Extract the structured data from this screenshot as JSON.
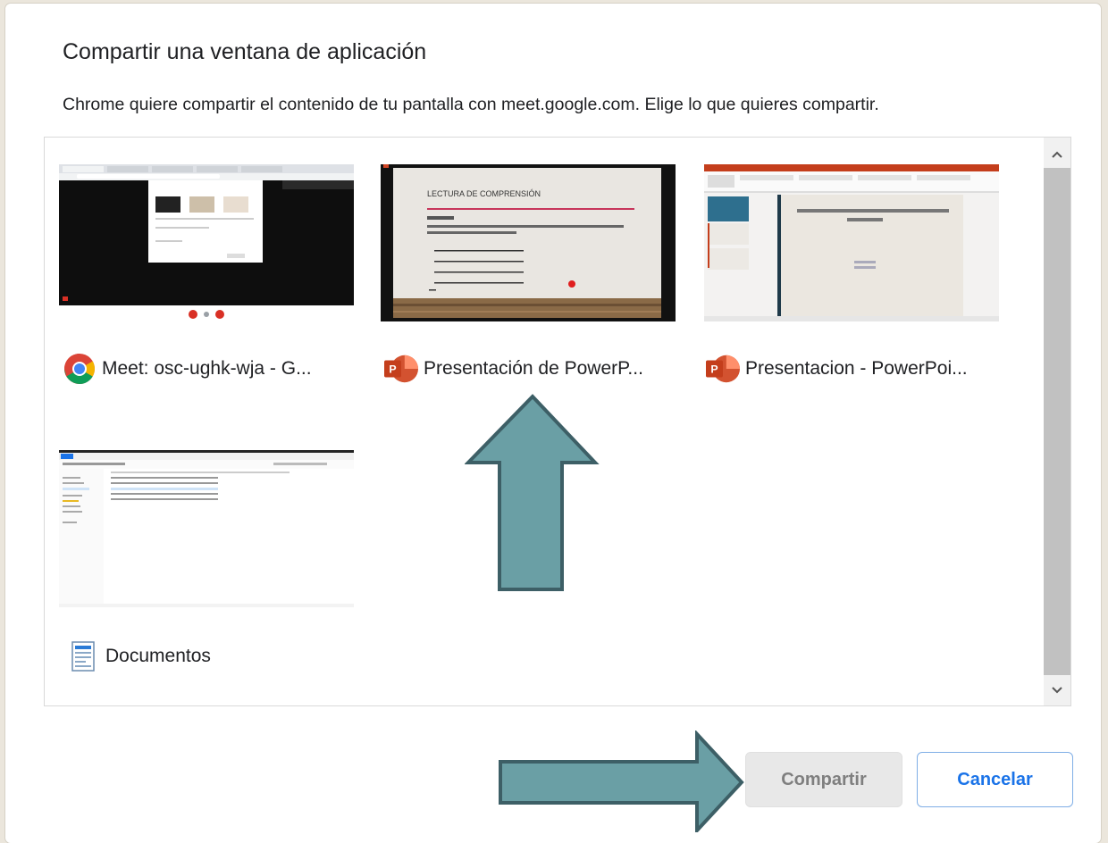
{
  "dialog": {
    "title": "Compartir una ventana de aplicación",
    "subtitle": "Chrome quiere compartir el contenido de tu pantalla con meet.google.com. Elige lo que quieres compartir."
  },
  "windows": [
    {
      "label": "Meet: osc-ughk-wja - G...",
      "icon": "chrome-icon"
    },
    {
      "label": "Presentación de PowerP...",
      "icon": "powerpoint-icon",
      "slide_title": "LECTURA DE COMPRENSIÓN"
    },
    {
      "label": "Presentacion - PowerPoi...",
      "icon": "powerpoint-icon"
    },
    {
      "label": "Documentos",
      "icon": "file-explorer-icon"
    }
  ],
  "buttons": {
    "share": "Compartir",
    "cancel": "Cancelar"
  },
  "colors": {
    "accent": "#1a73e8",
    "arrow": "#6a9fa5",
    "arrow_border": "#3d5f66",
    "background": "#ebe6dc"
  }
}
